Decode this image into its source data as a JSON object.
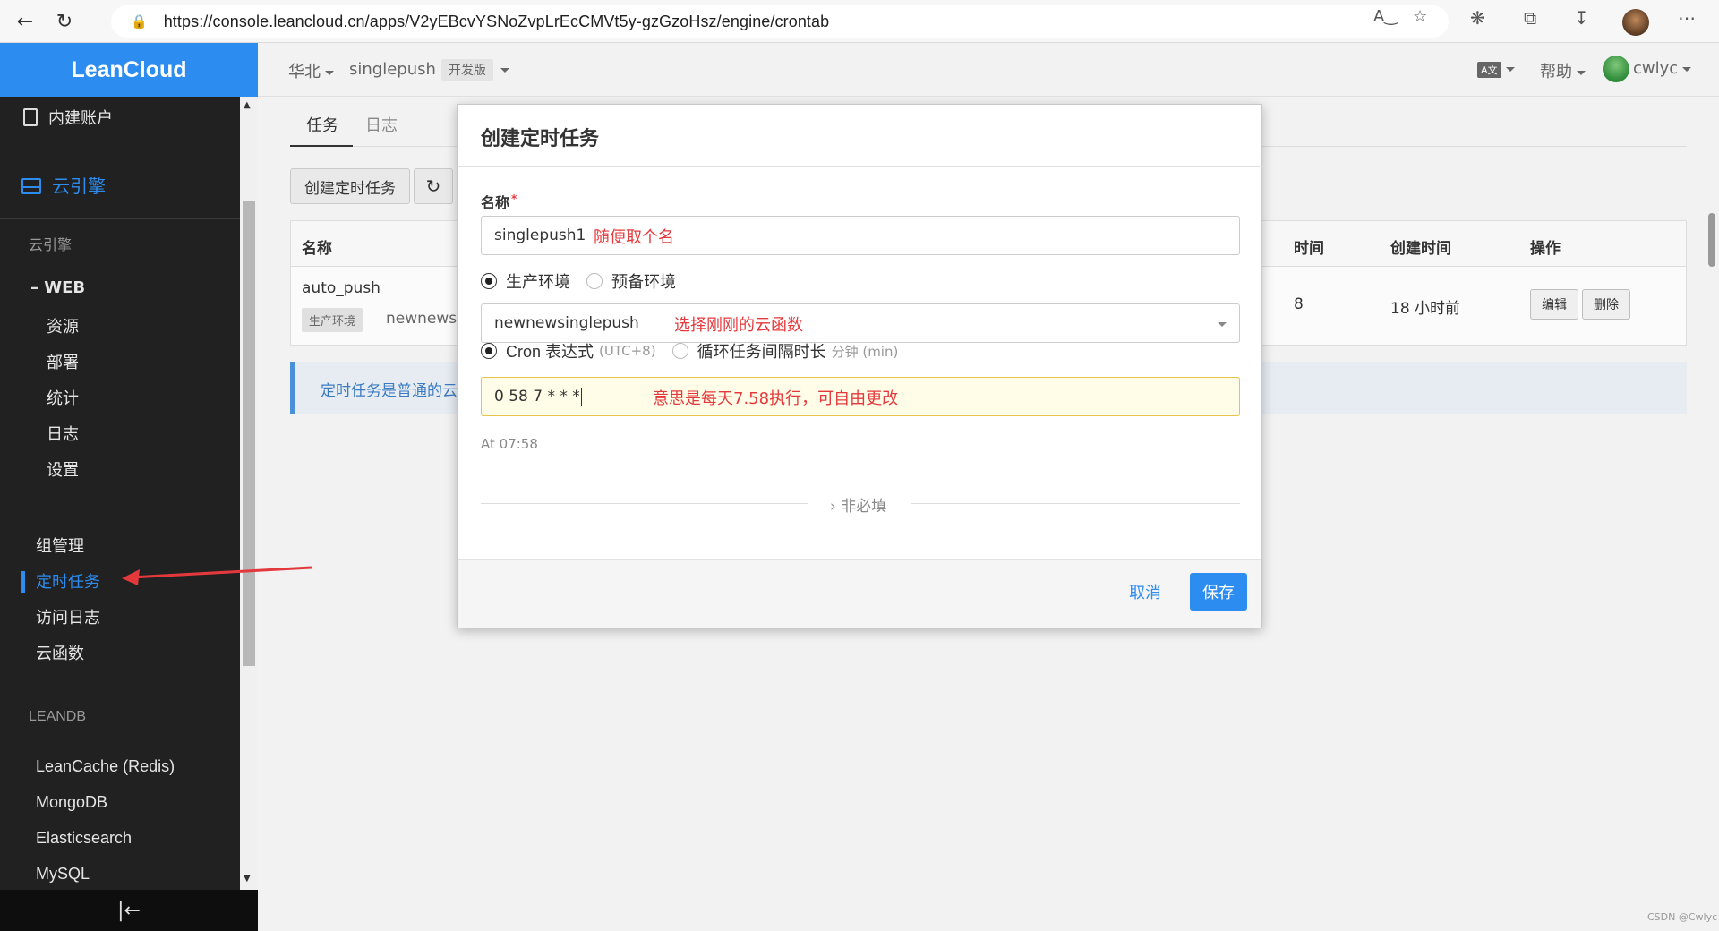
{
  "browser": {
    "url": "https://console.leancloud.cn/apps/V2yEBcvYSNoZvpLrEcCMVt5y-gzGzoHsz/engine/crontab"
  },
  "sidebar": {
    "brand": "LeanCloud",
    "account": "内建账户",
    "engine": "云引擎",
    "section_engine": "云引擎",
    "web_group": "WEB",
    "web_items": [
      "资源",
      "部署",
      "统计",
      "日志",
      "设置"
    ],
    "engine_items": [
      "组管理",
      "定时任务",
      "访问日志",
      "云函数"
    ],
    "active_item": "定时任务",
    "section_leandb": "LEANDB",
    "db_items": [
      "LeanCache (Redis)",
      "MongoDB",
      "Elasticsearch",
      "MySQL"
    ],
    "collapse_icon": "collapse-left-icon"
  },
  "header": {
    "region": "华北",
    "app_name": "singlepush",
    "app_tier": "开发版",
    "help": "帮助",
    "user": "cwlyc"
  },
  "main": {
    "tabs": [
      "任务",
      "日志"
    ],
    "create_button": "创建定时任务",
    "table": {
      "headers": [
        "名称",
        "时间",
        "创建时间",
        "操作"
      ],
      "row": {
        "name": "auto_push",
        "env_badge": "生产环境",
        "function": "newnewsi",
        "time_partial": "8",
        "created": "18 小时前",
        "edit": "编辑",
        "delete": "删除"
      }
    },
    "info_text": "定时任务是普通的云"
  },
  "modal": {
    "title": "创建定时任务",
    "name_label": "名称",
    "name_value": "singlepush1",
    "name_note": "随便取个名",
    "env_production": "生产环境",
    "env_staging": "预备环境",
    "function_value": "newnewsinglepush",
    "function_note": "选择刚刚的云函数",
    "cron_label": "Cron 表达式",
    "cron_tz": "(UTC+8)",
    "interval_label": "循环任务间隔时长",
    "interval_unit": "分钟 (min)",
    "cron_value": "0 58 7 * * *",
    "cron_note": "意思是每天7.58执行，可自由更改",
    "cron_hint": "At 07:58",
    "optional_label": "非必填",
    "cancel": "取消",
    "save": "保存"
  },
  "watermark": "CSDN @Cwlyc",
  "colors": {
    "brand": "#2d8cf0",
    "annotation": "#e4393c",
    "sidebar_bg": "#212121"
  }
}
